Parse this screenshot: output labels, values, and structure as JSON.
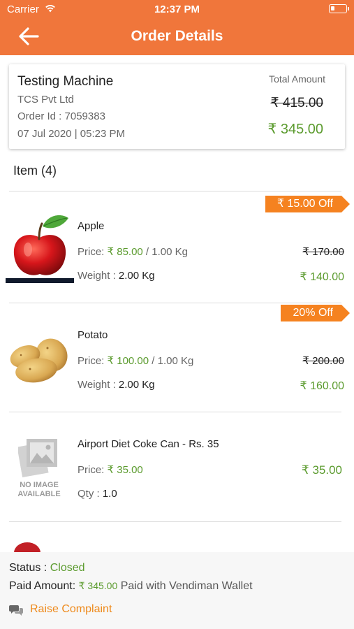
{
  "status_bar": {
    "carrier": "Carrier",
    "time": "12:37 PM"
  },
  "header": {
    "title": "Order Details"
  },
  "summary": {
    "customer_name": "Testing Machine",
    "company": "TCS Pvt Ltd",
    "order_id": "Order Id : 7059383",
    "date": "07 Jul 2020 | 05:23 PM",
    "total_label": "Total Amount",
    "total_original": "₹ 415.00",
    "total_final": "₹ 345.00"
  },
  "items_title": "Item (4)",
  "items": [
    {
      "name": "Apple",
      "badge": "₹ 15.00 Off",
      "price_label": "Price: ",
      "price_value": "₹ 85.00",
      "price_unit": " / 1.00 Kg",
      "qty_label": "Weight : ",
      "qty_value": "2.00 Kg",
      "original_total": "₹ 170.00",
      "final_total": "₹ 140.00",
      "image_icon": "apple-image"
    },
    {
      "name": "Potato",
      "badge": "20% Off",
      "price_label": "Price: ",
      "price_value": "₹ 100.00",
      "price_unit": " / 1.00 Kg",
      "qty_label": "Weight : ",
      "qty_value": "2.00 Kg",
      "original_total": "₹ 200.00",
      "final_total": "₹ 160.00",
      "image_icon": "potato-image"
    },
    {
      "name": "Airport Diet Coke Can - Rs. 35",
      "price_label": "Price: ",
      "price_value": "₹ 35.00",
      "qty_label": "Qty : ",
      "qty_value": "1.0",
      "final_total": "₹ 35.00",
      "image_icon": "no-image-placeholder",
      "image_text_line1": "NO IMAGE",
      "image_text_line2": "AVAILABLE"
    }
  ],
  "bottom": {
    "status_label": "Status : ",
    "status_value": "Closed",
    "paid_label": "Paid Amount: ",
    "paid_value": "₹ 345.00",
    "paid_method": " Paid with Vendiman Wallet",
    "complaint_label": "Raise Complaint"
  },
  "colors": {
    "header": "#f0763b",
    "badge": "#f58220",
    "price_green": "#5b9b2e",
    "complaint_orange": "#ee8a1c"
  }
}
